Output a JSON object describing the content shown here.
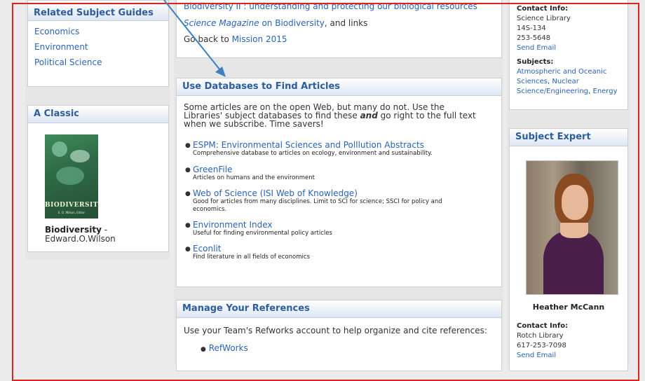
{
  "left": {
    "related_title": "Related Subject Guides",
    "related_items": [
      "Economics",
      "Environment",
      "Political Science"
    ],
    "classic_title": "A Classic",
    "book_cover_title": "BIODIVERSITY",
    "book_cover_author": "E. O. Wilson, Editor",
    "book_title": "Biodiversity",
    "book_author_sep": " - ",
    "book_author": "Edward.O.Wilson"
  },
  "center": {
    "top_link1": "Biodiversity II : understanding and protecting our biological resources",
    "top_link2": "Science Magazine",
    "top_link2_rest": " on Biodiversity",
    "top_text2": ", and links",
    "go_back_text": "Go back to ",
    "go_back_link": "Mission 2015",
    "db_title": "Use Databases to Find Articles",
    "db_intro_a": "Some articles are on the open Web, but many do not. Use the Libraries' subject databases to find these ",
    "db_intro_em": "and",
    "db_intro_b": " go right to the full text when we subscribe. Time savers!",
    "databases": [
      {
        "name": "ESPM: Environmental Sciences and Polllution Abstracts",
        "desc": "Comprehensive database to articles on ecology, environment and sustainability."
      },
      {
        "name": "GreenFile",
        "desc": "Articles on humans and the environment"
      },
      {
        "name": "Web of Science (ISI Web of Knowledge)",
        "desc": "Good for articles from many disciplines. Limit to SCI for science; SSCI for policy and economics."
      },
      {
        "name": "Environment Index",
        "desc": "Useful for finding environmental policy articles"
      },
      {
        "name": "Econlit",
        "desc": "Find literature in all fields of economics"
      }
    ],
    "refs_title": "Manage Your References",
    "refs_text": "Use your Team's Refworks account to help organize and cite references:",
    "refs_items": [
      "RefWorks"
    ]
  },
  "right": {
    "contact1_label": "Contact Info:",
    "contact1_lines": [
      "Science Library",
      "14S-134",
      "253-5648"
    ],
    "contact1_email": "Send Email",
    "subjects_label": "Subjects:",
    "subjects_a": "Atmospheric and Oceanic Sciences",
    "subjects_sep1": ", ",
    "subjects_b": "Nuclear Science/Engineering",
    "subjects_sep2": ", ",
    "subjects_c": "Energy",
    "expert_title": "Subject Expert",
    "expert_name": "Heather McCann",
    "contact2_label": "Contact Info:",
    "contact2_lines": [
      "Rotch Library",
      "617-253-7098"
    ],
    "contact2_email": "Send Email"
  },
  "colors": {
    "annotation": "#e0231f",
    "arrow": "#3f7fc0",
    "header_text": "#2d5d9c",
    "link": "#2a63b6"
  }
}
